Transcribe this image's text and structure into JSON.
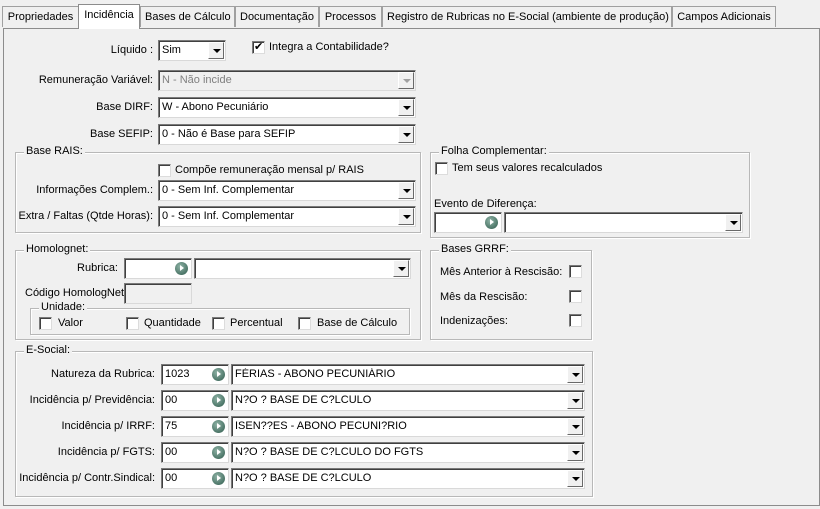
{
  "tabs": [
    {
      "label": "Propriedades"
    },
    {
      "label": "Incidência"
    },
    {
      "label": "Bases de Cálculo"
    },
    {
      "label": "Documentação"
    },
    {
      "label": "Processos"
    },
    {
      "label": "Registro de Rubricas no E-Social (ambiente de produção)"
    },
    {
      "label": "Campos Adicionais"
    }
  ],
  "general": {
    "liquido_label": "Líquido :",
    "liquido_value": "Sim",
    "integra_label": "Integra a Contabilidade?",
    "integra_checked": true,
    "remuneracao_label": "Remuneração Variável:",
    "remuneracao_value": "N - Não incide",
    "base_dirf_label": "Base DIRF:",
    "base_dirf_value": "W - Abono Pecuniário",
    "base_sefip_label": "Base SEFIP:",
    "base_sefip_value": "0 - Não é Base para SEFIP"
  },
  "rais": {
    "caption": "Base RAIS:",
    "compoe_label": "Compõe remuneração mensal p/ RAIS",
    "info_label": "Informações Complem.:",
    "info_value": "0 - Sem Inf. Complementar",
    "extra_label": "Extra / Faltas (Qtde Horas):",
    "extra_value": "0 - Sem Inf. Complementar"
  },
  "folha": {
    "caption": "Folha Complementar:",
    "recalc_label": "Tem seus valores recalculados",
    "evento_label": "Evento de Diferença:",
    "evento_code": "",
    "evento_value": ""
  },
  "homolognet": {
    "caption": "Homolognet:",
    "rubrica_label": "Rubrica:",
    "codigo_label": "Código HomologNet",
    "unidade_caption": "Unidade:",
    "unidades": [
      "Valor",
      "Quantidade",
      "Percentual",
      "Base de Cálculo"
    ]
  },
  "grrf": {
    "caption": "Bases GRRF:",
    "items": [
      "Mês Anterior à Rescisão:",
      "Mês da Rescisão:",
      "Indenizações:"
    ]
  },
  "esocial": {
    "caption": "E-Social:",
    "rows": [
      {
        "label": "Natureza da Rubrica:",
        "code": "1023",
        "value": "FÉRIAS - ABONO PECUNIÁRIO"
      },
      {
        "label": "Incidência p/ Previdência:",
        "code": "00",
        "value": "N?O ? BASE DE C?LCULO"
      },
      {
        "label": "Incidência p/ IRRF:",
        "code": "75",
        "value": "ISEN??ES - ABONO PECUNI?RIO"
      },
      {
        "label": "Incidência p/ FGTS:",
        "code": "00",
        "value": "N?O ? BASE DE C?LCULO DO FGTS"
      },
      {
        "label": "Incidência p/ Contr.Sindical:",
        "code": "00",
        "value": "N?O ? BASE DE C?LCULO"
      }
    ]
  }
}
